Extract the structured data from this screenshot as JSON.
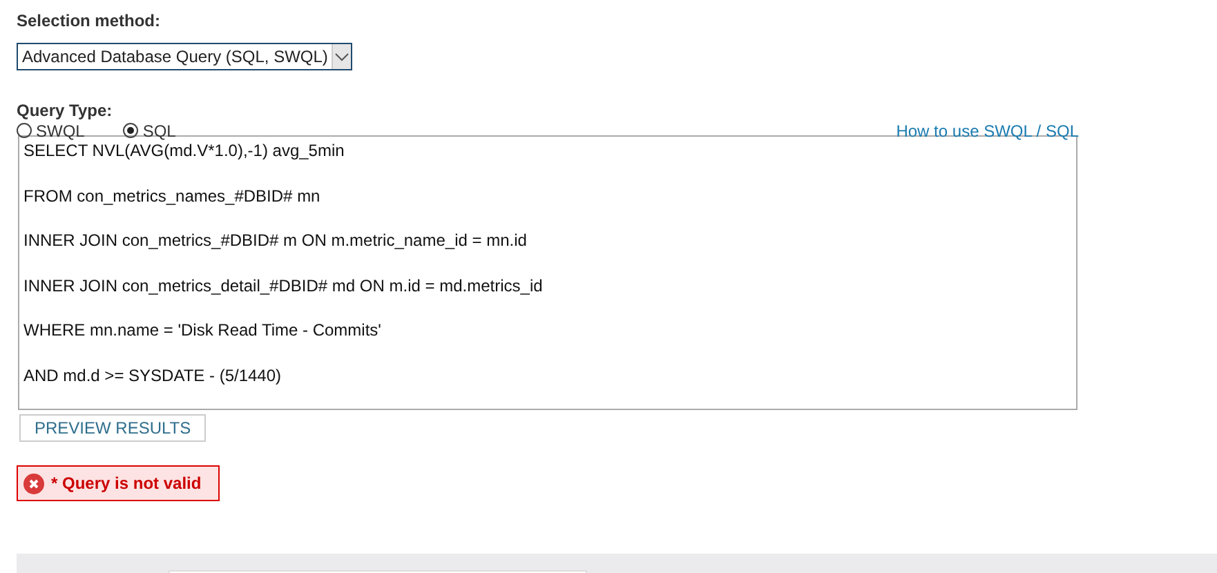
{
  "selection_method": {
    "label": "Selection method:",
    "value": "Advanced Database Query (SQL, SWQL)"
  },
  "query_type": {
    "label": "Query Type:",
    "options": [
      {
        "label": "SWQL",
        "selected": false
      },
      {
        "label": "SQL",
        "selected": true
      }
    ]
  },
  "help_link": "How to use SWQL / SQL",
  "query": {
    "lines": [
      "SELECT NVL(AVG(md.V*1.0),-1) avg_5min",
      "FROM con_metrics_names_#DBID# mn",
      "INNER JOIN con_metrics_#DBID# m ON m.metric_name_id = mn.id",
      "INNER JOIN con_metrics_detail_#DBID# md ON m.id = md.metrics_id",
      "WHERE mn.name = 'Disk Read Time - Commits'",
      "AND md.d >= SYSDATE - (5/1440)"
    ]
  },
  "preview_button": "PREVIEW RESULTS",
  "error": {
    "text": "* Query is not valid"
  }
}
